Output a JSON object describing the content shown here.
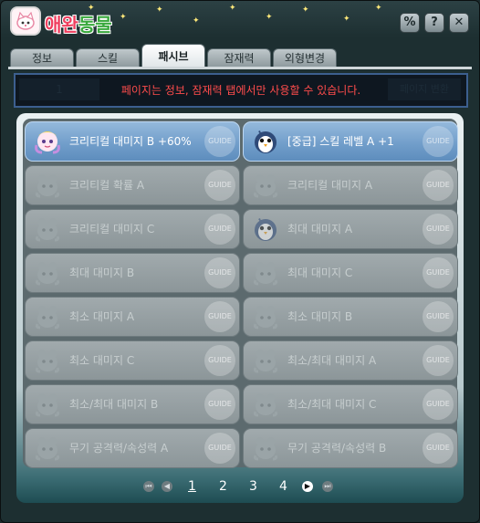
{
  "window": {
    "title_part1": "애완",
    "title_part2": "동물"
  },
  "titlebar_buttons": [
    {
      "symbol": "%",
      "icon": "percent-icon"
    },
    {
      "symbol": "?",
      "icon": "help-icon"
    },
    {
      "symbol": "✕",
      "icon": "close-icon"
    }
  ],
  "tabs": [
    {
      "label": "정보"
    },
    {
      "label": "스킬"
    },
    {
      "label": "패시브",
      "active": true
    },
    {
      "label": "잠재력"
    },
    {
      "label": "외형변경"
    }
  ],
  "notice": {
    "message": "페이지는 정보, 잠재력 탭에서만 사용할 수 있습니다.",
    "ghost_left": "1",
    "ghost_right": "페이지 변환"
  },
  "passives": [
    {
      "label": "크리티컬 대미지 B +60%",
      "active": true,
      "icon": "fairy-pet-icon"
    },
    {
      "label": "[중급] 스킬 레벨 A +1",
      "active": true,
      "icon": "penguin-pet-icon"
    },
    {
      "label": "크리티컬 확률 A",
      "active": false,
      "icon": "ghost-pet-icon"
    },
    {
      "label": "크리티컬 대미지 A",
      "active": false,
      "icon": "ghost-pet-icon"
    },
    {
      "label": "크리티컬 대미지 C",
      "active": false,
      "icon": "ghost-pet-icon"
    },
    {
      "label": "최대 대미지 A",
      "active": false,
      "icon": "penguin-pet-icon"
    },
    {
      "label": "최대 대미지 B",
      "active": false,
      "icon": "ghost-pet-icon"
    },
    {
      "label": "최대 대미지 C",
      "active": false,
      "icon": "ghost-pet-icon"
    },
    {
      "label": "최소 대미지 A",
      "active": false,
      "icon": "ghost-pet-icon"
    },
    {
      "label": "최소 대미지 B",
      "active": false,
      "icon": "ghost-pet-icon"
    },
    {
      "label": "최소 대미지 C",
      "active": false,
      "icon": "ghost-pet-icon"
    },
    {
      "label": "최소/최대 대미지 A",
      "active": false,
      "icon": "ghost-pet-icon"
    },
    {
      "label": "최소/최대 대미지 B",
      "active": false,
      "icon": "ghost-pet-icon"
    },
    {
      "label": "최소/최대 대미지 C",
      "active": false,
      "icon": "ghost-pet-icon"
    },
    {
      "label": "무기 공격력/속성력 A",
      "active": false,
      "icon": "ghost-pet-icon"
    },
    {
      "label": "무기 공격력/속성력 B",
      "active": false,
      "icon": "ghost-pet-icon"
    }
  ],
  "guide_label": "GUIDE",
  "pagination": {
    "pages": [
      "1",
      "2",
      "3",
      "4"
    ],
    "current": "1"
  },
  "colors": {
    "notice_text": "#ff4c4c",
    "active_slot": "#6f9cc9",
    "inactive_slot": "#8c9699"
  }
}
